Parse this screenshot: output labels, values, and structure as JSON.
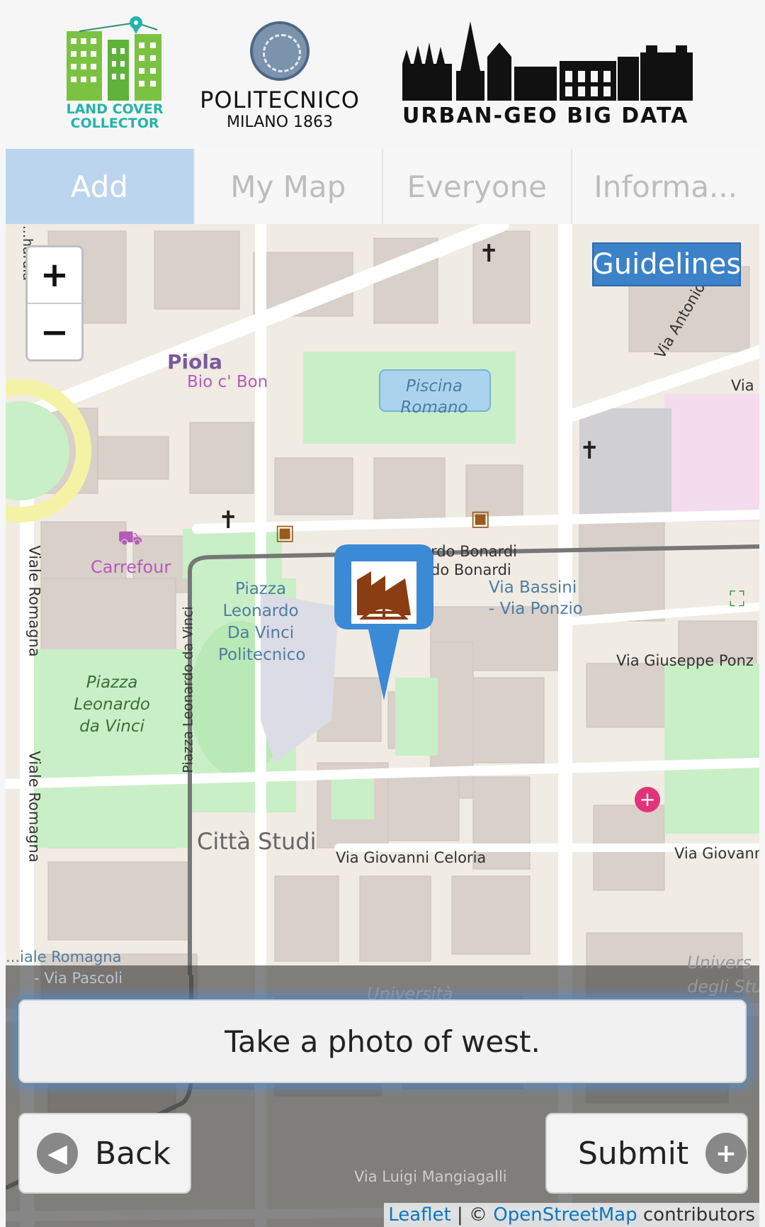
{
  "header": {
    "logos": {
      "land_cover_line1": "LAND COVER",
      "land_cover_line2": "COLLECTOR",
      "polimi_name": "POLITECNICO",
      "polimi_sub": "MILANO 1863",
      "ugbd": "URBAN-GEO BIG DATA"
    }
  },
  "tabs": [
    {
      "label": "Add",
      "active": true
    },
    {
      "label": "My Map",
      "active": false
    },
    {
      "label": "Everyone",
      "active": false
    },
    {
      "label": "Informa...",
      "active": false
    }
  ],
  "map": {
    "zoom_in": "+",
    "zoom_out": "−",
    "guidelines_label": "Guidelines",
    "labels": {
      "piola": "Piola",
      "bio_c_bon": "Bio c' Bon",
      "piscina1": "Piscina",
      "piscina2": "Romano",
      "carrefour": "Carrefour",
      "piazza_ldv_pol1": "Piazza",
      "piazza_ldv_pol2": "Leonardo",
      "piazza_ldv_pol3": "Da Vinci",
      "piazza_ldv_pol4": "Politecnico",
      "piazza_ldv1": "Piazza",
      "piazza_ldv2": "Leonardo",
      "piazza_ldv3": "da Vinci",
      "bonardi1": "...rdo Bonardi",
      "bonardi2": "...do Bonardi",
      "bassini1": "Via Bassini",
      "bassini2": "- Via Ponzio",
      "ponzio": "Via Giuseppe Ponz",
      "citta_studi": "Città Studi",
      "celoria": "Via Giovanni Celoria",
      "giovann": "Via Giovann",
      "viale_romagna1": "Viale Romagna",
      "viale_romagna2": "Viale Romagna",
      "viale_romagna3": "...iale Romagna",
      "via_pascoli": "- Via Pascoli",
      "piazzale_ldv": "Piazza Leonardo da Vinci",
      "via_antonio": "Via Antonio Va",
      "via_right": "Via",
      "universita": "Università",
      "univers": "Univers",
      "degli": "degli Stu",
      "mangiagalli": "Via Luigi Mangiagalli",
      "hardia": "...hardia"
    },
    "instruction": "Take a photo of west.",
    "back_label": "Back",
    "submit_label": "Submit",
    "attribution_leaflet": "Leaflet",
    "attribution_sep": " | © ",
    "attribution_osm": "OpenStreetMap",
    "attribution_tail": " contributors"
  },
  "colors": {
    "tab_active_bg": "#bcd5ee",
    "guidelines_bg": "#3b82c9",
    "marker_blue": "#3b8ad6",
    "marker_brown": "#8a3d10",
    "land_cover_green": "#22b5a8"
  }
}
